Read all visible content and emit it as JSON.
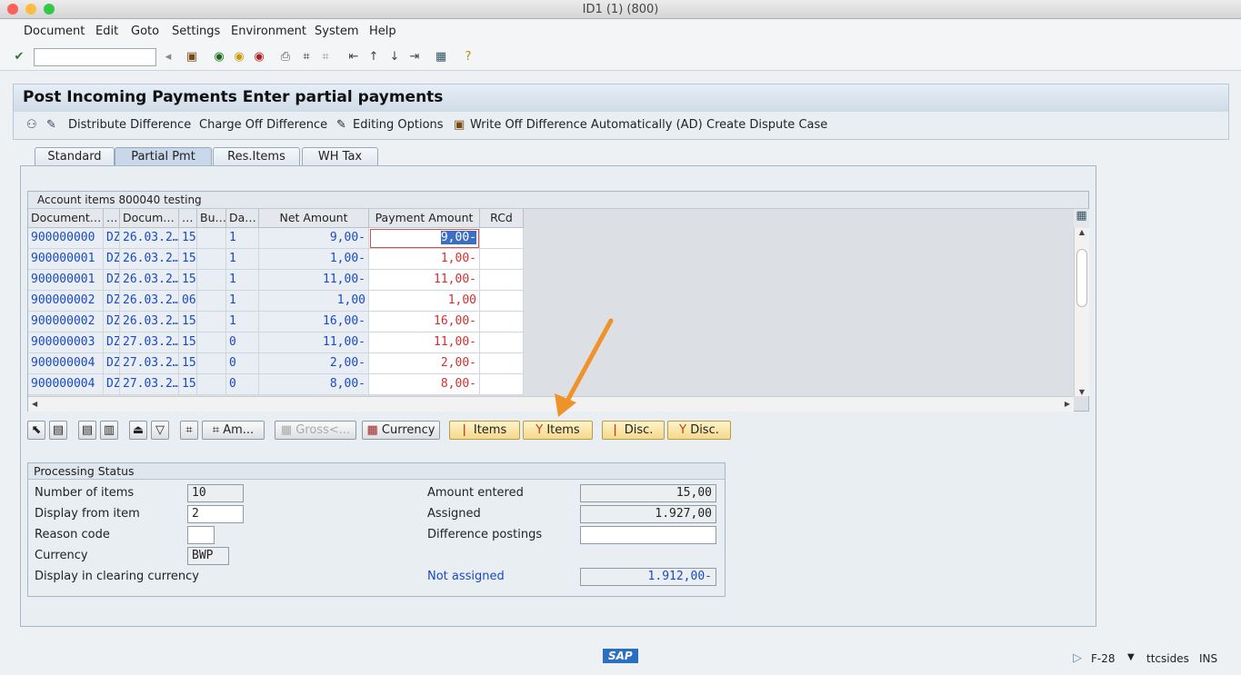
{
  "window": {
    "title": "ID1 (1) (800)"
  },
  "menu": [
    "Document",
    "Edit",
    "Goto",
    "Settings",
    "Environment",
    "System",
    "Help"
  ],
  "toolbar": {
    "command_value": "",
    "icons": [
      "enter-icon",
      "back-arrow-icon",
      "save-icon",
      "back-icon",
      "exit-icon",
      "cancel-icon",
      "print-icon",
      "find-icon",
      "find-next-icon",
      "first-page-icon",
      "prev-page-icon",
      "next-page-icon",
      "last-page-icon",
      "layout-icon",
      "help-icon"
    ]
  },
  "screen": {
    "title": "Post Incoming Payments Enter partial payments"
  },
  "app_toolbar": [
    "Distribute Difference",
    "Charge Off Difference",
    "Editing Options",
    "Write Off Difference Automatically (AD)",
    "Create Dispute Case"
  ],
  "tabs": [
    {
      "label": "Standard"
    },
    {
      "label": "Partial Pmt",
      "active": true
    },
    {
      "label": "Res.Items"
    },
    {
      "label": "WH Tax"
    }
  ],
  "grid": {
    "title": "Account items 800040 testing",
    "columns": [
      "Document…",
      "…",
      "Docum…",
      "…",
      "Bu…",
      "Da…",
      "Net Amount",
      "Payment Amount",
      "RCd"
    ],
    "rows": [
      [
        "900000000",
        "DZ",
        "26.03.2…",
        "15",
        "",
        "1",
        "9,00-",
        "9,00-",
        ""
      ],
      [
        "900000001",
        "DZ",
        "26.03.2…",
        "15",
        "",
        "1",
        "1,00-",
        "1,00-",
        ""
      ],
      [
        "900000001",
        "DZ",
        "26.03.2…",
        "15",
        "",
        "1",
        "11,00-",
        "11,00-",
        ""
      ],
      [
        "900000002",
        "DZ",
        "26.03.2…",
        "06",
        "",
        "1",
        "1,00",
        "1,00",
        ""
      ],
      [
        "900000002",
        "DZ",
        "26.03.2…",
        "15",
        "",
        "1",
        "16,00-",
        "16,00-",
        ""
      ],
      [
        "900000003",
        "DZ",
        "27.03.2…",
        "15",
        "",
        "0",
        "11,00-",
        "11,00-",
        ""
      ],
      [
        "900000004",
        "DZ",
        "27.03.2…",
        "15",
        "",
        "0",
        "2,00-",
        "2,00-",
        ""
      ],
      [
        "900000004",
        "DZ",
        "27.03.2…",
        "15",
        "",
        "0",
        "8,00-",
        "8,00-",
        ""
      ]
    ]
  },
  "grid_buttons": {
    "amount": "Am...",
    "gross": "Gross<...",
    "currency": "Currency",
    "items_activate": "Items",
    "items_deactivate": "Items",
    "disc_activate": "Disc.",
    "disc_deactivate": "Disc."
  },
  "processing_status": {
    "title": "Processing Status",
    "number_of_items_label": "Number of items",
    "number_of_items": "10",
    "display_from_label": "Display from item",
    "display_from": "2",
    "reason_code_label": "Reason code",
    "reason_code": "",
    "currency_label": "Currency",
    "currency": "BWP",
    "display_clearing_label": "Display in clearing currency",
    "amount_entered_label": "Amount entered",
    "amount_entered": "15,00",
    "assigned_label": "Assigned",
    "assigned": "1.927,00",
    "difference_postings_label": "Difference postings",
    "difference_postings": "",
    "not_assigned_label": "Not assigned",
    "not_assigned": "1.912,00-"
  },
  "statusbar": {
    "logo": "SAP",
    "transaction": "F-28",
    "server": "ttcsides",
    "mode": "INS"
  },
  "colors": {
    "blue_text": "#1a4ac0",
    "red_text": "#d03030",
    "arrow": "#f0922a",
    "selection": "#3b6fc4"
  }
}
